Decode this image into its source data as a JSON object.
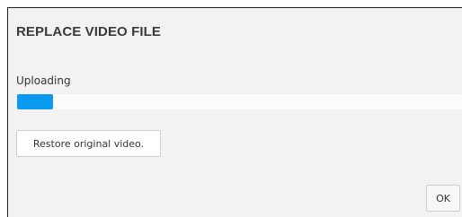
{
  "dialog": {
    "title": "REPLACE VIDEO FILE",
    "status_label": "Uploading",
    "progress_percent": 8,
    "progress_color": "#0a9bf0",
    "restore_label": "Restore original video.",
    "ok_label": "OK"
  }
}
